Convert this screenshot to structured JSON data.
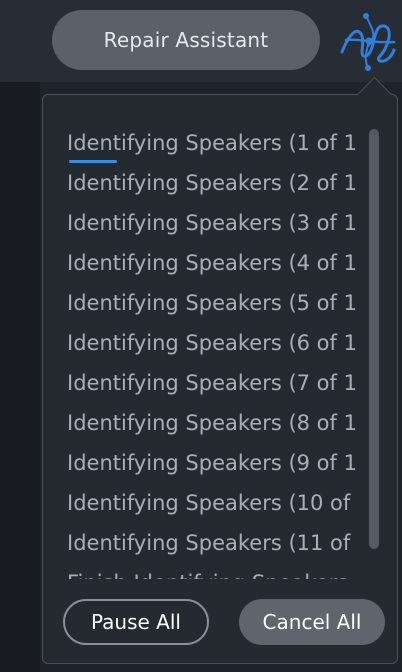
{
  "header": {
    "repair_assistant_label": "Repair Assistant",
    "logo_icon": "waveform-logo-icon"
  },
  "popup": {
    "tasks": [
      {
        "label": "Identifying Speakers (1 of 1",
        "progress": 0.15
      },
      {
        "label": "Identifying Speakers (2 of 1"
      },
      {
        "label": "Identifying Speakers (3 of 1"
      },
      {
        "label": "Identifying Speakers (4 of 1"
      },
      {
        "label": "Identifying Speakers (5 of 1"
      },
      {
        "label": "Identifying Speakers (6 of 1"
      },
      {
        "label": "Identifying Speakers (7 of 1"
      },
      {
        "label": "Identifying Speakers (8 of 1"
      },
      {
        "label": "Identifying Speakers (9 of 1"
      },
      {
        "label": "Identifying Speakers (10 of"
      },
      {
        "label": "Identifying Speakers (11 of"
      },
      {
        "label": "Finish Identifying Speakers"
      }
    ],
    "pause_all_label": "Pause All",
    "cancel_all_label": "Cancel All"
  },
  "colors": {
    "accent": "#3b8ee8",
    "logo": "#2f7fe0"
  }
}
